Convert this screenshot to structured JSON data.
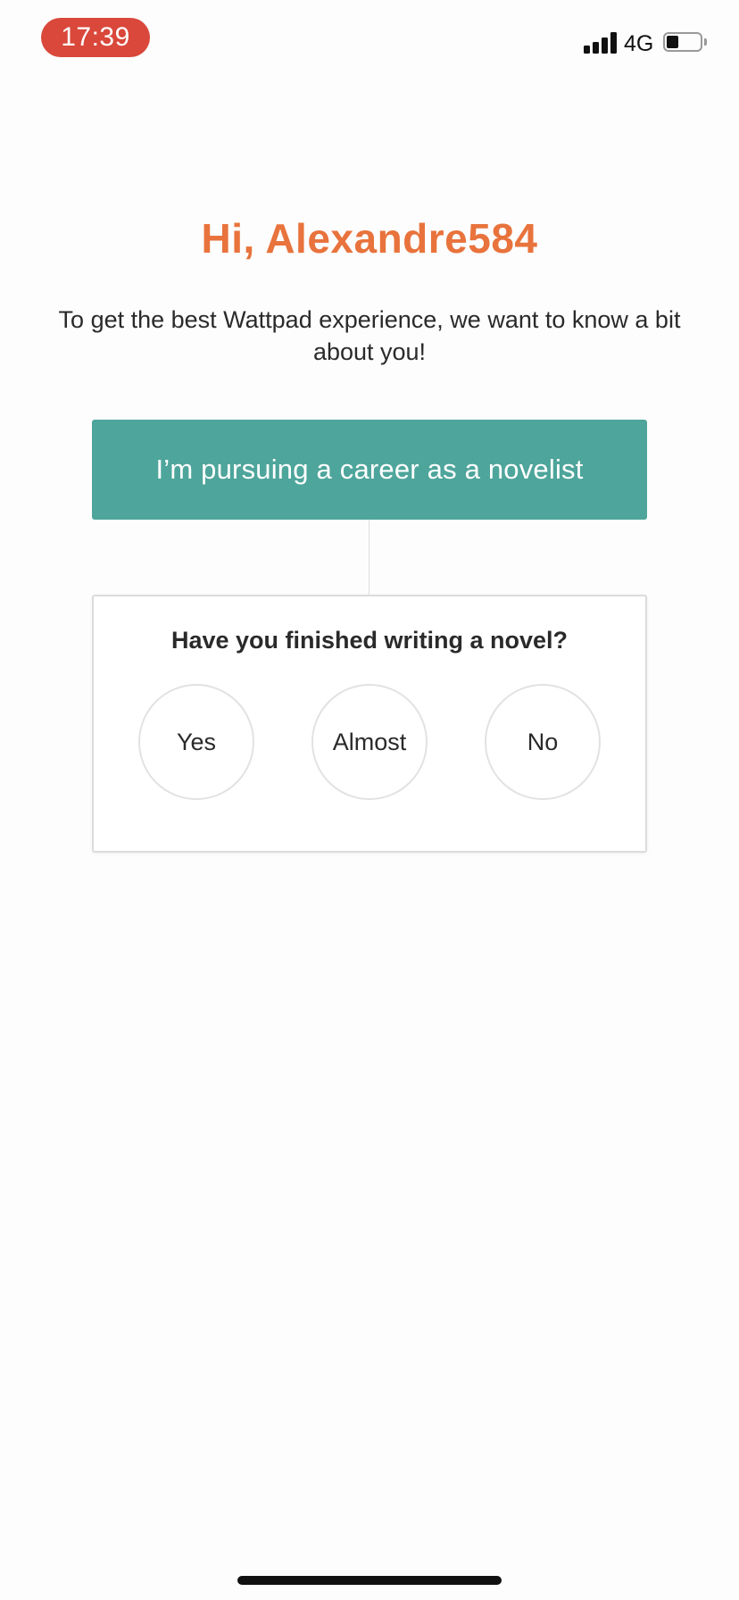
{
  "status_bar": {
    "time": "17:39",
    "network": "4G",
    "signal_bars": 4,
    "battery_level": 0.35,
    "time_pill_color": "#d9483b"
  },
  "onboarding": {
    "greeting": "Hi, Alexandre584",
    "intro": "To get the best Wattpad experience, we want to know a bit about you!",
    "selected_option": "I’m pursuing a career as a novelist",
    "question": "Have you finished writing a novel?",
    "answers": [
      {
        "label": "Yes"
      },
      {
        "label": "Almost"
      },
      {
        "label": "No"
      }
    ]
  },
  "colors": {
    "accent_orange": "#e8733c",
    "selected_teal": "#4ea59b"
  }
}
